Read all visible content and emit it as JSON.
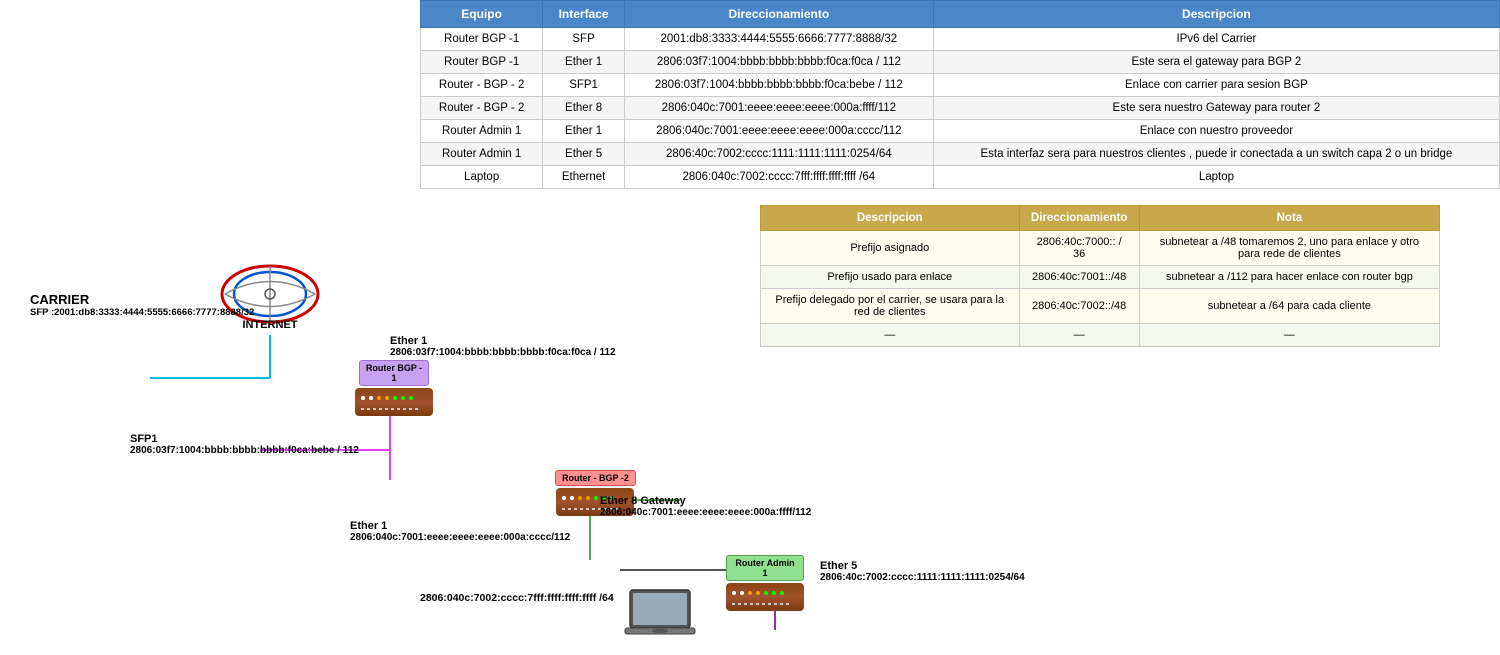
{
  "tables": {
    "main": {
      "headers": [
        "Equipo",
        "Interface",
        "Direccionamiento",
        "Descripcion"
      ],
      "rows": [
        {
          "equipo": "Router BGP -1",
          "interface": "SFP",
          "direccionamiento": "2001:db8:3333:4444:5555:6666:7777:8888/32",
          "descripcion": "IPv6 del Carrier"
        },
        {
          "equipo": "Router BGP -1",
          "interface": "Ether 1",
          "direccionamiento": "2806:03f7:1004:bbbb:bbbb:bbbb:f0ca:f0ca / 112",
          "descripcion": "Este sera el gateway para BGP 2"
        },
        {
          "equipo": "Router - BGP - 2",
          "interface": "SFP1",
          "direccionamiento": "2806:03f7:1004:bbbb:bbbb:bbbb:f0ca:bebe / 112",
          "descripcion": "Enlace con carrier para sesion BGP"
        },
        {
          "equipo": "Router - BGP - 2",
          "interface": "Ether 8",
          "direccionamiento": "2806:040c:7001:eeee:eeee:eeee:000a:ffff/112",
          "descripcion": "Este sera nuestro Gateway para router 2"
        },
        {
          "equipo": "Router Admin 1",
          "interface": "Ether 1",
          "direccionamiento": "2806:040c:7001:eeee:eeee:eeee:000a:cccc/112",
          "descripcion": "Enlace con nuestro proveedor"
        },
        {
          "equipo": "Router Admin 1",
          "interface": "Ether 5",
          "direccionamiento": "2806:40c:7002:cccc:1111:1111:1111:0254/64",
          "descripcion": "Esta interfaz sera para nuestros clientes , puede ir conectada a un switch capa 2 o un bridge"
        },
        {
          "equipo": "Laptop",
          "interface": "Ethernet",
          "direccionamiento": "2806:040c:7002:cccc:7fff:ffff:ffff:ffff /64",
          "descripcion": "Laptop"
        }
      ]
    },
    "second": {
      "headers": [
        "Descripcion",
        "Direccionamiento",
        "Nota"
      ],
      "rows": [
        {
          "descripcion": "Prefijo asignado",
          "direccionamiento": "2806:40c:7000:: / 36",
          "nota": "subnetear a /48  tomaremos 2, uno para enlace y otro para rede de clientes"
        },
        {
          "descripcion": "Prefijo usado para enlace",
          "direccionamiento": "2806:40c:7001::/48",
          "nota": "subnetear a /112 para hacer enlace con router bgp"
        },
        {
          "descripcion": "Prefijo delegado por el carrier, se usara para la red de clientes",
          "direccionamiento": "2806:40c:7002::/48",
          "nota": "subnetear a /64 para cada cliente"
        },
        {
          "descripcion": "—",
          "direccionamiento": "—",
          "nota": "—"
        }
      ]
    }
  },
  "diagram": {
    "internet_label": "INTERNET",
    "carrier_label": "CARRIER",
    "carrier_sfp": "SFP :2001:db8:3333:4444:5555:6666:7777:8888/32",
    "router_bgp1_label": "Router BGP -\n1",
    "router_bgp2_label": "Router - BGP -2",
    "router_admin1_label": "Router Admin 1",
    "bgp1_ether1_title": "Ether 1",
    "bgp1_ether1_addr": "2806:03f7:1004:bbbb:bbbb:bbbb:f0ca:f0ca / 112",
    "bgp2_sfp1_title": "SFP1",
    "bgp2_sfp1_addr": "2806:03f7:1004:bbbb:bbbb:bbbb:f0ca:bebe / 112",
    "bgp2_ether8_title": "Ether 8 Gateway",
    "bgp2_ether8_addr": "2806:040c:7001:eeee:eeee:eeee:000a:ffff/112",
    "admin1_ether1_title": "Ether 1",
    "admin1_ether1_addr": "2806:040c:7001:eeee:eeee:eeee:000a:cccc/112",
    "admin1_ether5_title": "Ether 5",
    "admin1_ether5_addr": "2806:40c:7002:cccc:1111:1111:1111:0254/64",
    "laptop_addr": "2806:040c:7002:cccc:7fff:ffff:ffff:ffff /64"
  }
}
